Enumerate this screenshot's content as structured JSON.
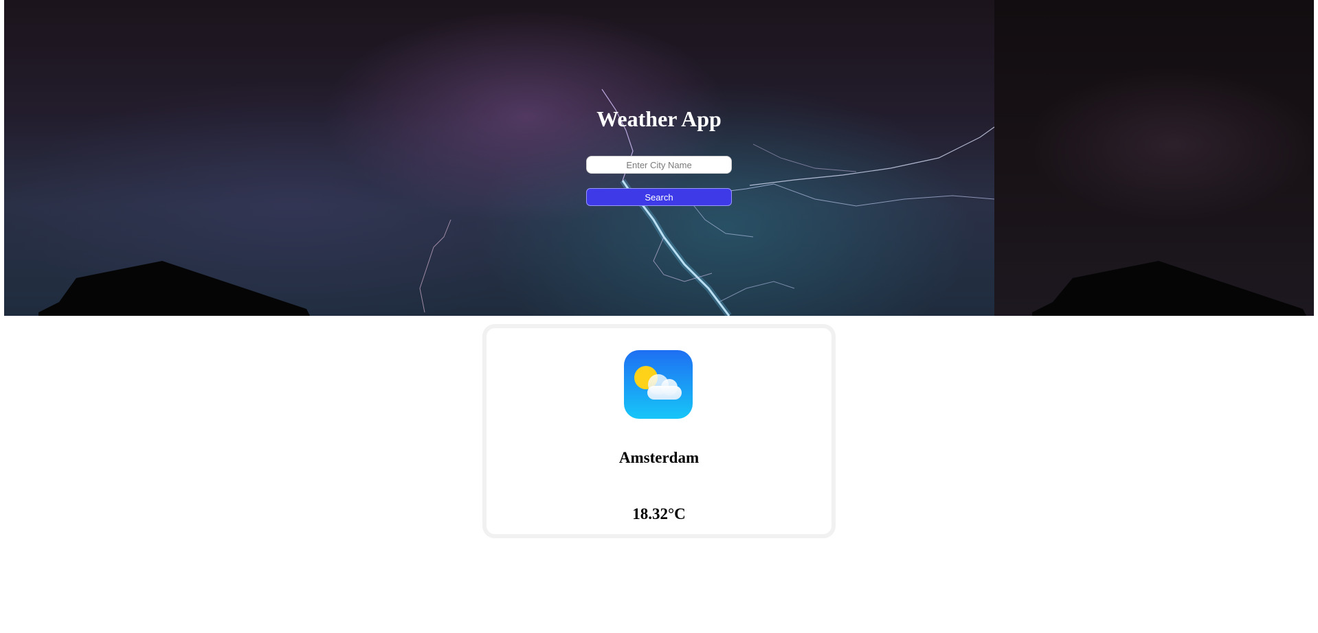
{
  "header": {
    "title": "Weather App"
  },
  "search": {
    "placeholder": "Enter City Name",
    "value": "",
    "button_label": "Search"
  },
  "weather": {
    "icon": "partly-cloudy-icon",
    "city": "Amsterdam",
    "temperature": "18.32°C"
  },
  "colors": {
    "button": "#3e3ae8",
    "card_border": "#f1f1f1",
    "icon_gradient_top": "#1e6ff2",
    "icon_gradient_bottom": "#17c6f8",
    "sun": "#ffd21a"
  }
}
